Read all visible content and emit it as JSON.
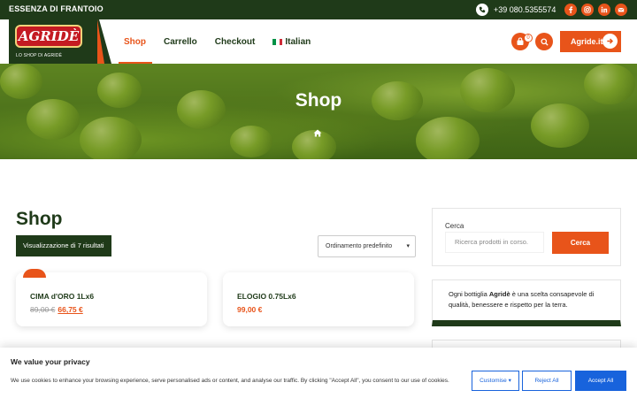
{
  "topbar": {
    "tagline": "ESSENZA DI FRANTOIO",
    "phone": "+39 080.5355574",
    "phone_icon": "phone-icon",
    "socials": [
      "facebook-icon",
      "instagram-icon",
      "linkedin-icon",
      "email-icon"
    ]
  },
  "header": {
    "logo_text": "AGRIDÈ",
    "logo_subtitle": "LO SHOP DI AGRIDÈ",
    "nav": [
      {
        "label": "Shop",
        "active": true
      },
      {
        "label": "Carrello",
        "active": false
      },
      {
        "label": "Checkout",
        "active": false
      },
      {
        "label": "Italian",
        "active": false
      }
    ],
    "cart_count": "0",
    "site_button": "Agride.it"
  },
  "hero": {
    "title": "Shop",
    "breadcrumb_icon": "home-icon"
  },
  "main": {
    "heading": "Shop",
    "results_text": "Visualizzazione di 7 risultati",
    "order_select": "Ordinamento predefinito",
    "products": [
      {
        "name": "CIMA d'ORO 1Lx6",
        "old_price": "89,00 €",
        "price": "66,75 €",
        "on_sale": true
      },
      {
        "name": "ELOGIO 0.75Lx6",
        "old_price": "",
        "price": "99,00 €",
        "on_sale": false
      }
    ]
  },
  "sidebar": {
    "search_label": "Cerca",
    "search_placeholder": "Ricerca prodotti in corso.",
    "search_button": "Cerca",
    "info_pre": "Ogni bottiglia ",
    "info_bold": "Agridè",
    "info_post": " è una scelta consapevole di qualità, benessere e rispetto per la terra."
  },
  "cookie": {
    "title": "We value your privacy",
    "text": "We use cookies to enhance your browsing experience, serve personalised ads or content, and analyse our traffic. By clicking \"Accept All\", you consent to our use of cookies.",
    "customise": "Customise",
    "reject": "Reject All",
    "accept": "Accept All"
  },
  "colors": {
    "brand_green": "#1f3a19",
    "accent_orange": "#e8541a",
    "cookie_blue": "#1863dc"
  }
}
